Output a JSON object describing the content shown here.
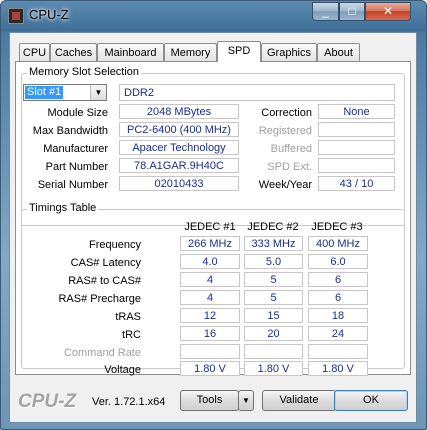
{
  "window": {
    "title": "CPU-Z",
    "minimize": "_",
    "maximize": "□",
    "close": "✕"
  },
  "tabs": [
    "CPU",
    "Caches",
    "Mainboard",
    "Memory",
    "SPD",
    "Graphics",
    "About"
  ],
  "active_tab": "SPD",
  "memory_slot": {
    "group_title": "Memory Slot Selection",
    "slot": "Slot #1",
    "type": "DDR2",
    "fields": [
      {
        "label": "Module Size",
        "value": "2048 MBytes"
      },
      {
        "label": "Max Bandwidth",
        "value": "PC2-6400 (400 MHz)"
      },
      {
        "label": "Manufacturer",
        "value": "Apacer Technology"
      },
      {
        "label": "Part Number",
        "value": "78.A1GAR.9H40C"
      },
      {
        "label": "Serial Number",
        "value": "02010433"
      }
    ],
    "right_fields": [
      {
        "label": "Correction",
        "value": "None",
        "enabled": true
      },
      {
        "label": "Registered",
        "value": "",
        "enabled": false
      },
      {
        "label": "Buffered",
        "value": "",
        "enabled": false
      },
      {
        "label": "SPD Ext.",
        "value": "",
        "enabled": false
      },
      {
        "label": "Week/Year",
        "value": "43 / 10",
        "enabled": true
      }
    ]
  },
  "timings": {
    "group_title": "Timings Table",
    "columns": [
      "JEDEC #1",
      "JEDEC #2",
      "JEDEC #3"
    ],
    "rows": [
      {
        "label": "Frequency",
        "values": [
          "266 MHz",
          "333 MHz",
          "400 MHz"
        ],
        "enabled": true
      },
      {
        "label": "CAS# Latency",
        "values": [
          "4.0",
          "5.0",
          "6.0"
        ],
        "enabled": true
      },
      {
        "label": "RAS# to CAS#",
        "values": [
          "4",
          "5",
          "6"
        ],
        "enabled": true
      },
      {
        "label": "RAS# Precharge",
        "values": [
          "4",
          "5",
          "6"
        ],
        "enabled": true
      },
      {
        "label": "tRAS",
        "values": [
          "12",
          "15",
          "18"
        ],
        "enabled": true
      },
      {
        "label": "tRC",
        "values": [
          "16",
          "20",
          "24"
        ],
        "enabled": true
      },
      {
        "label": "Command Rate",
        "values": [
          "",
          "",
          ""
        ],
        "enabled": false
      },
      {
        "label": "Voltage",
        "values": [
          "1.80 V",
          "1.80 V",
          "1.80 V"
        ],
        "enabled": true
      }
    ]
  },
  "footer": {
    "brand": "CPU-Z",
    "version": "Ver. 1.72.1.x64",
    "tools_label": "Tools",
    "validate_label": "Validate",
    "ok_label": "OK"
  },
  "icons": {
    "app": "cpu-z-icon",
    "dropdown": "chevron-down-icon",
    "tools_menu": "chevron-down-icon"
  }
}
